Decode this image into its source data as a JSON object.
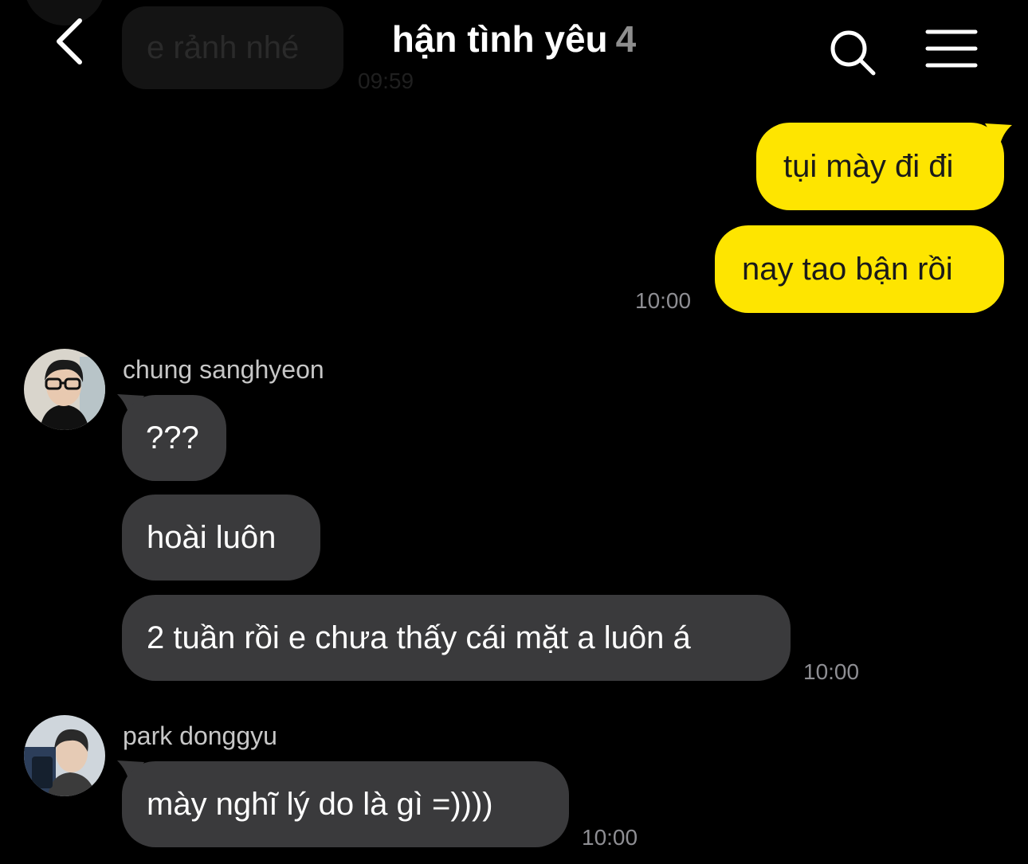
{
  "previous": {
    "text": "e rảnh nhé",
    "time": "09:59"
  },
  "header": {
    "title": "hận tình yêu",
    "member_count": "4"
  },
  "messages": {
    "me_1": "tụi mày đi đi",
    "me_2": "nay tao bận rồi",
    "me_time": "10:00",
    "sang": {
      "name": "chung sanghyeon",
      "m1": "???",
      "m2": "hoài luôn",
      "m3": "2 tuần rồi e chưa thấy cái mặt a luôn á",
      "time": "10:00"
    },
    "park": {
      "name": "park donggyu",
      "m1": "mày nghĩ lý do là gì =))))",
      "time": "10:00"
    }
  },
  "colors": {
    "background": "#000000",
    "my_bubble": "#fee500",
    "other_bubble": "#3a3a3c"
  }
}
